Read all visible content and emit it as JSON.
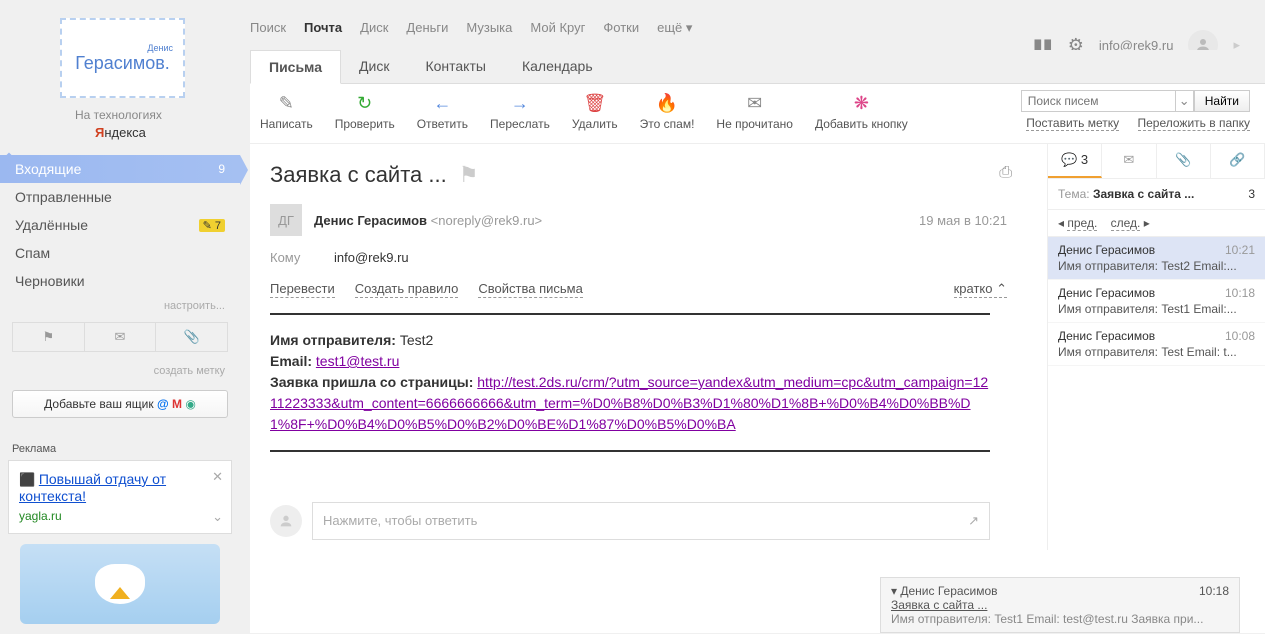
{
  "topnav": [
    "Поиск",
    "Почта",
    "Диск",
    "Деньги",
    "Музыка",
    "Мой Круг",
    "Фотки",
    "ещё ▾"
  ],
  "topnav_active": 1,
  "logo": {
    "name_top": "Денис",
    "name": "Герасимов.",
    "tech": "На технологиях",
    "yandex": "ндекса"
  },
  "account_email": "info@rek9.ru",
  "folders": [
    {
      "name": "Входящие",
      "badge": "9",
      "active": true
    },
    {
      "name": "Отправленные"
    },
    {
      "name": "Удалённые",
      "badge": "7",
      "yellow": true
    },
    {
      "name": "Спам"
    },
    {
      "name": "Черновики"
    }
  ],
  "sidebar": {
    "settings": "настроить...",
    "create_label": "создать метку",
    "add_box": "Добавьте ваш ящик",
    "ad_label": "Реклама"
  },
  "ad": {
    "title": "Повышай отдачу от контекста!",
    "site": "yagla.ru",
    "icon": "⬛"
  },
  "main_tabs": [
    "Письма",
    "Диск",
    "Контакты",
    "Календарь"
  ],
  "main_tabs_active": 0,
  "tools": [
    {
      "icon": "✎",
      "color": "#888",
      "label": "Написать"
    },
    {
      "icon": "↻",
      "color": "#3a3",
      "label": "Проверить"
    },
    {
      "icon": "←",
      "color": "#58d",
      "label": "Ответить"
    },
    {
      "icon": "→",
      "color": "#58d",
      "label": "Переслать"
    },
    {
      "icon": "🗑",
      "color": "#d44",
      "label": "Удалить"
    },
    {
      "icon": "🔥",
      "color": "#f80",
      "label": "Это спам!"
    },
    {
      "icon": "✉",
      "color": "#888",
      "label": "Не прочитано"
    },
    {
      "icon": "❋",
      "color": "#d48",
      "label": "Добавить кнопку"
    }
  ],
  "search": {
    "placeholder": "Поиск писем",
    "btn": "Найти",
    "link1": "Поставить метку",
    "link2": "Переложить в папку"
  },
  "email": {
    "subject": "Заявка с сайта ...",
    "avatar": "ДГ",
    "sender": "Денис Герасимов",
    "sender_addr": "<noreply@rek9.ru>",
    "date": "19 мая в 10:21",
    "to_label": "Кому",
    "to": "info@rek9.ru",
    "actions": [
      "Перевести",
      "Создать правило",
      "Свойства письма"
    ],
    "brief": "кратко ⌃",
    "body_sender_label": "Имя отправителя:",
    "body_sender": "Test2",
    "body_email_label": "Email:",
    "body_email": "test1@test.ru",
    "body_page_label": "Заявка пришла со страницы:",
    "body_url": "http://test.2ds.ru/crm/?utm_source=yandex&utm_medium=cpc&utm_campaign=1211223333&utm_content=6666666666&utm_term=%D0%B8%D0%B3%D1%80%D1%8B+%D0%B4%D0%BB%D1%8F+%D0%B4%D0%B5%D0%B2%D0%BE%D1%87%D0%B5%D0%BA",
    "reply_placeholder": "Нажмите, чтобы ответить"
  },
  "thread": {
    "count": "3",
    "subj_label": "Тема:",
    "subj": "Заявка с сайта ...",
    "subj_count": "3",
    "prev": "пред.",
    "next": "след.",
    "items": [
      {
        "name": "Денис Герасимов",
        "time": "10:21",
        "body": "Имя отправителя: Test2 Email:...",
        "sel": true
      },
      {
        "name": "Денис Герасимов",
        "time": "10:18",
        "body": "Имя отправителя: Test1 Email:..."
      },
      {
        "name": "Денис Герасимов",
        "time": "10:08",
        "body": "Имя отправителя: Test Email: t..."
      }
    ]
  },
  "preview": {
    "name": "Денис Герасимов",
    "time": "10:18",
    "subj": "Заявка с сайта ...",
    "body": "Имя отправителя: Test1 Email: test@test.ru Заявка при..."
  }
}
